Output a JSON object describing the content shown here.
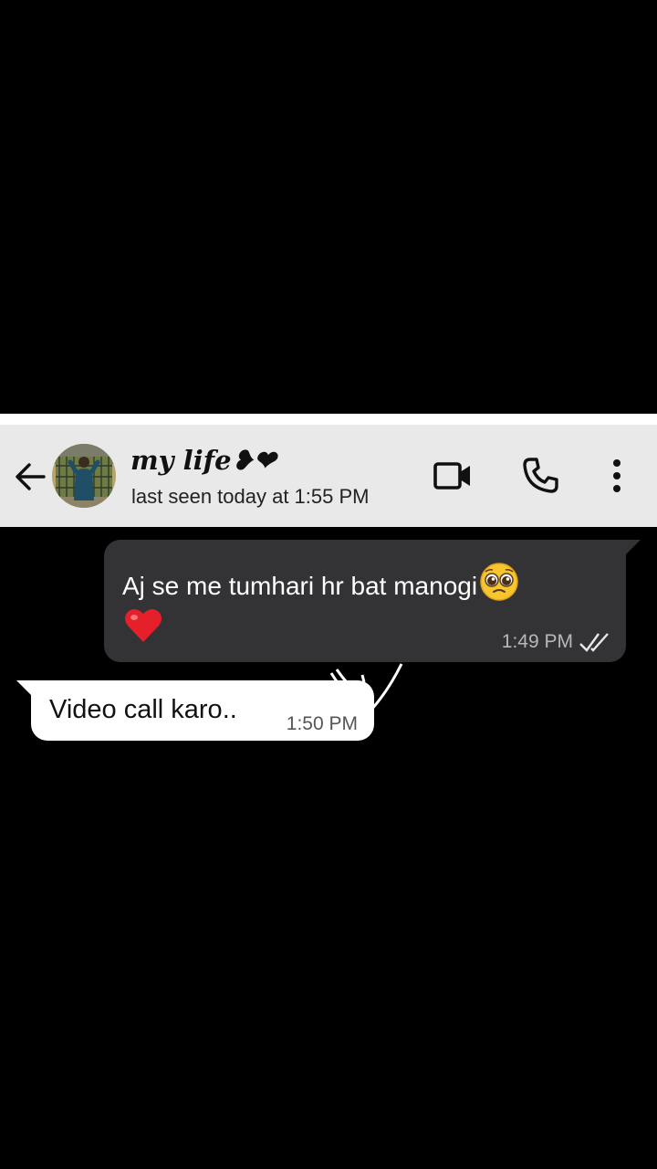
{
  "header": {
    "contact_name": "my life❥❤",
    "last_seen": "last seen today at 1:55 PM",
    "icons": [
      "back-arrow-icon",
      "video-call-icon",
      "phone-call-icon",
      "more-options-icon"
    ]
  },
  "messages": [
    {
      "direction": "outgoing",
      "text": "Aj se me tumhari hr bat manogi",
      "emoji": [
        "pleading-face-emoji",
        "red-heart-emoji"
      ],
      "time": "1:49 PM",
      "status": "double-check-read"
    },
    {
      "direction": "incoming",
      "text": "Video call karo..",
      "time": "1:50 PM"
    }
  ],
  "colors": {
    "header_bg": "#e9e9e9",
    "chat_bg": "#000000",
    "outgoing_bubble": "#333335",
    "incoming_bubble": "#ffffff"
  }
}
